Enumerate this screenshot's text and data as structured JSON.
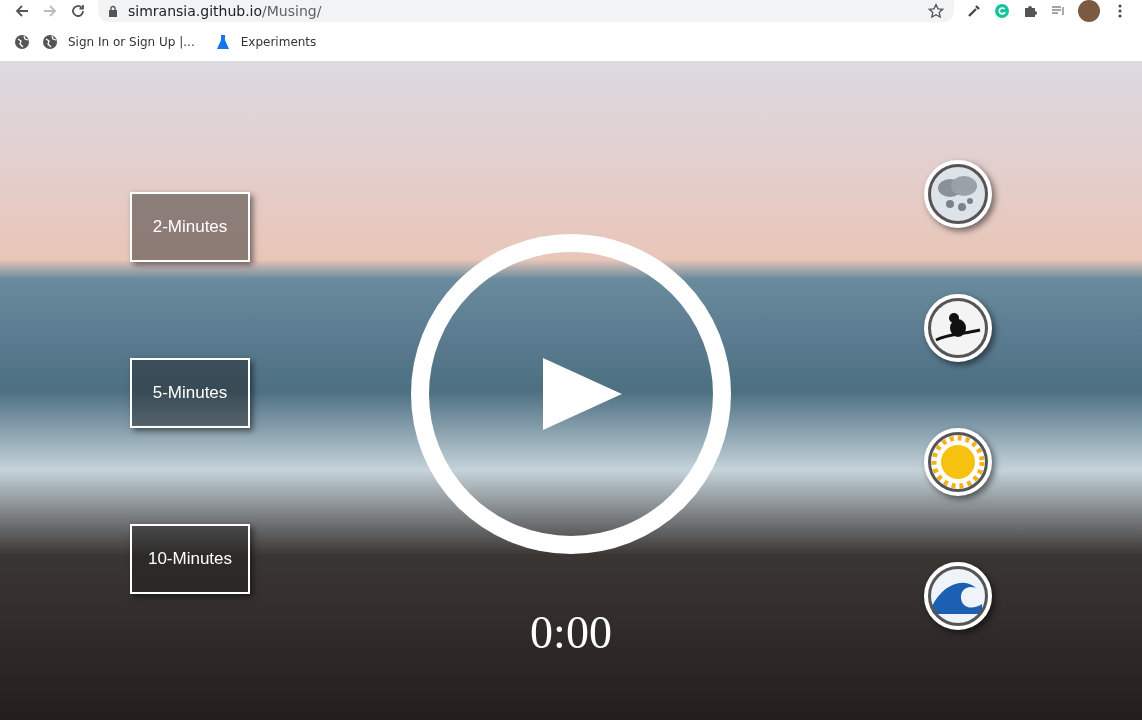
{
  "browser": {
    "url_host": "simransia.github.io",
    "url_path": "/Musing/",
    "bookmarks": [
      {
        "label": "Sign In or Sign Up |...",
        "kind": "globe"
      },
      {
        "label": "Experiments",
        "kind": "flask"
      }
    ]
  },
  "durations": [
    "2-Minutes",
    "5-Minutes",
    "10-Minutes"
  ],
  "timer": "0:00",
  "sounds": [
    {
      "kind": "rain"
    },
    {
      "kind": "bird"
    },
    {
      "kind": "sun"
    },
    {
      "kind": "wave"
    }
  ]
}
